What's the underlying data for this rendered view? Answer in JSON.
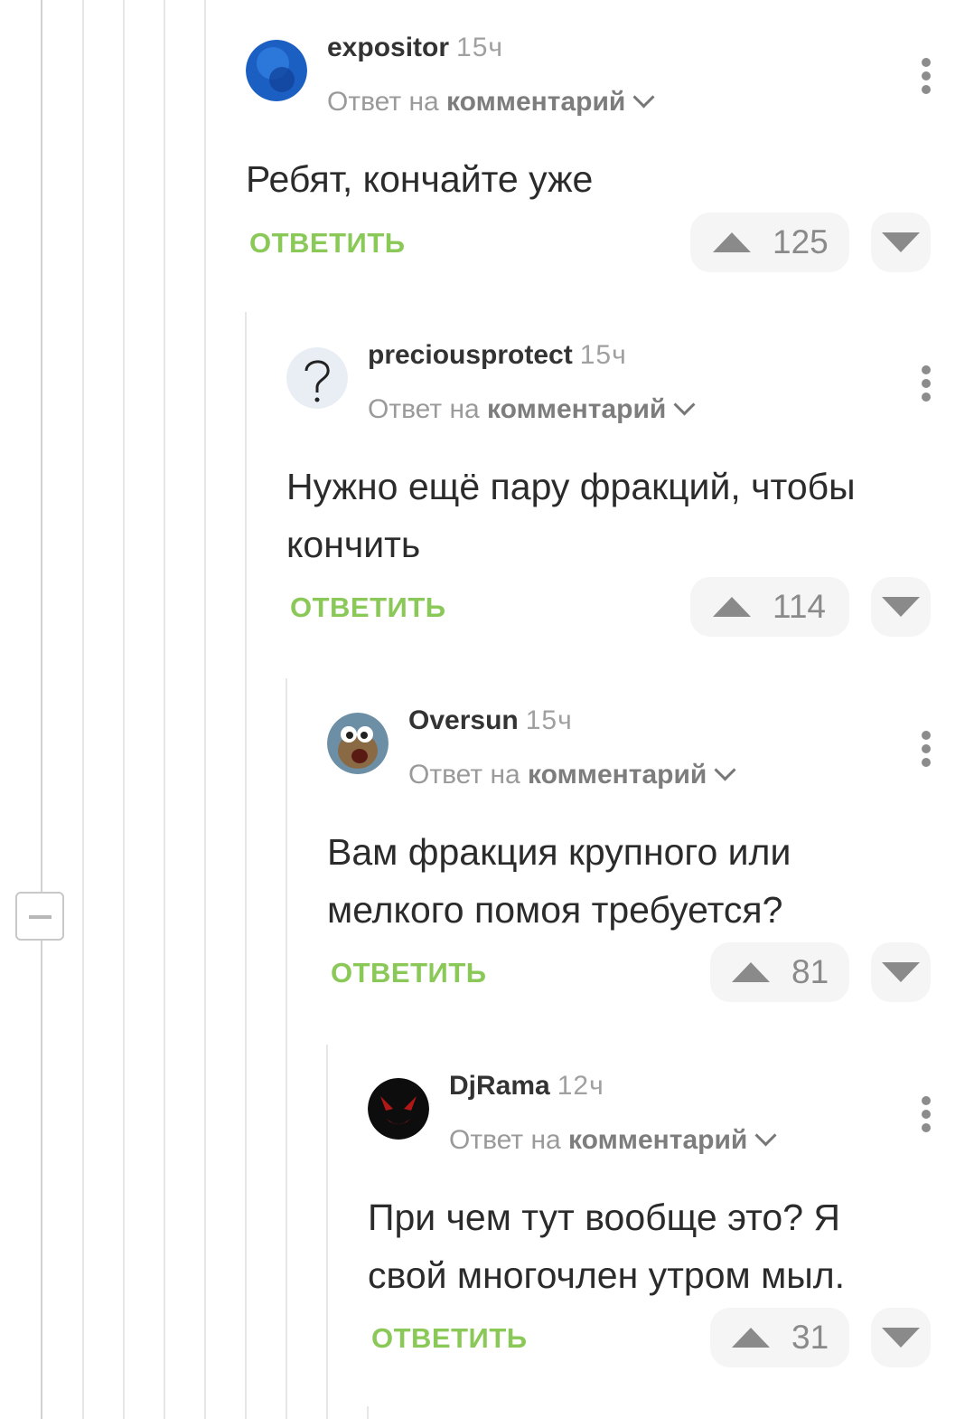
{
  "comments": [
    {
      "author": "expositor",
      "time": "15ч",
      "reply_prefix": "Ответ на",
      "reply_link": "комментарий",
      "text": "Ребят, кончайте уже",
      "reply_label": "ОТВЕТИТЬ",
      "rating": "125"
    },
    {
      "author": "preciousprotect",
      "time": "15ч",
      "reply_prefix": "Ответ на",
      "reply_link": "комментарий",
      "text_lines": [
        "Нужно ещё пару фракций, чтобы",
        "кончить"
      ],
      "reply_label": "ОТВЕТИТЬ",
      "rating": "114"
    },
    {
      "author": "Oversun",
      "time": "15ч",
      "reply_prefix": "Ответ на",
      "reply_link": "комментарий",
      "text_lines": [
        "Вам фракция крупного или",
        "мелкого помоя требуется?"
      ],
      "reply_label": "ОТВЕТИТЬ",
      "rating": "81"
    },
    {
      "author": "DjRama",
      "time": "12ч",
      "reply_prefix": "Ответ на",
      "reply_link": "комментарий",
      "text_lines": [
        "При чем тут вообще это? Я",
        "свой многочлен утром мыл."
      ],
      "reply_label": "ОТВЕТИТЬ",
      "rating": "31"
    }
  ],
  "colors": {
    "reply_green": "#8ac858",
    "author": "#333333",
    "muted": "#a0a0a0"
  }
}
